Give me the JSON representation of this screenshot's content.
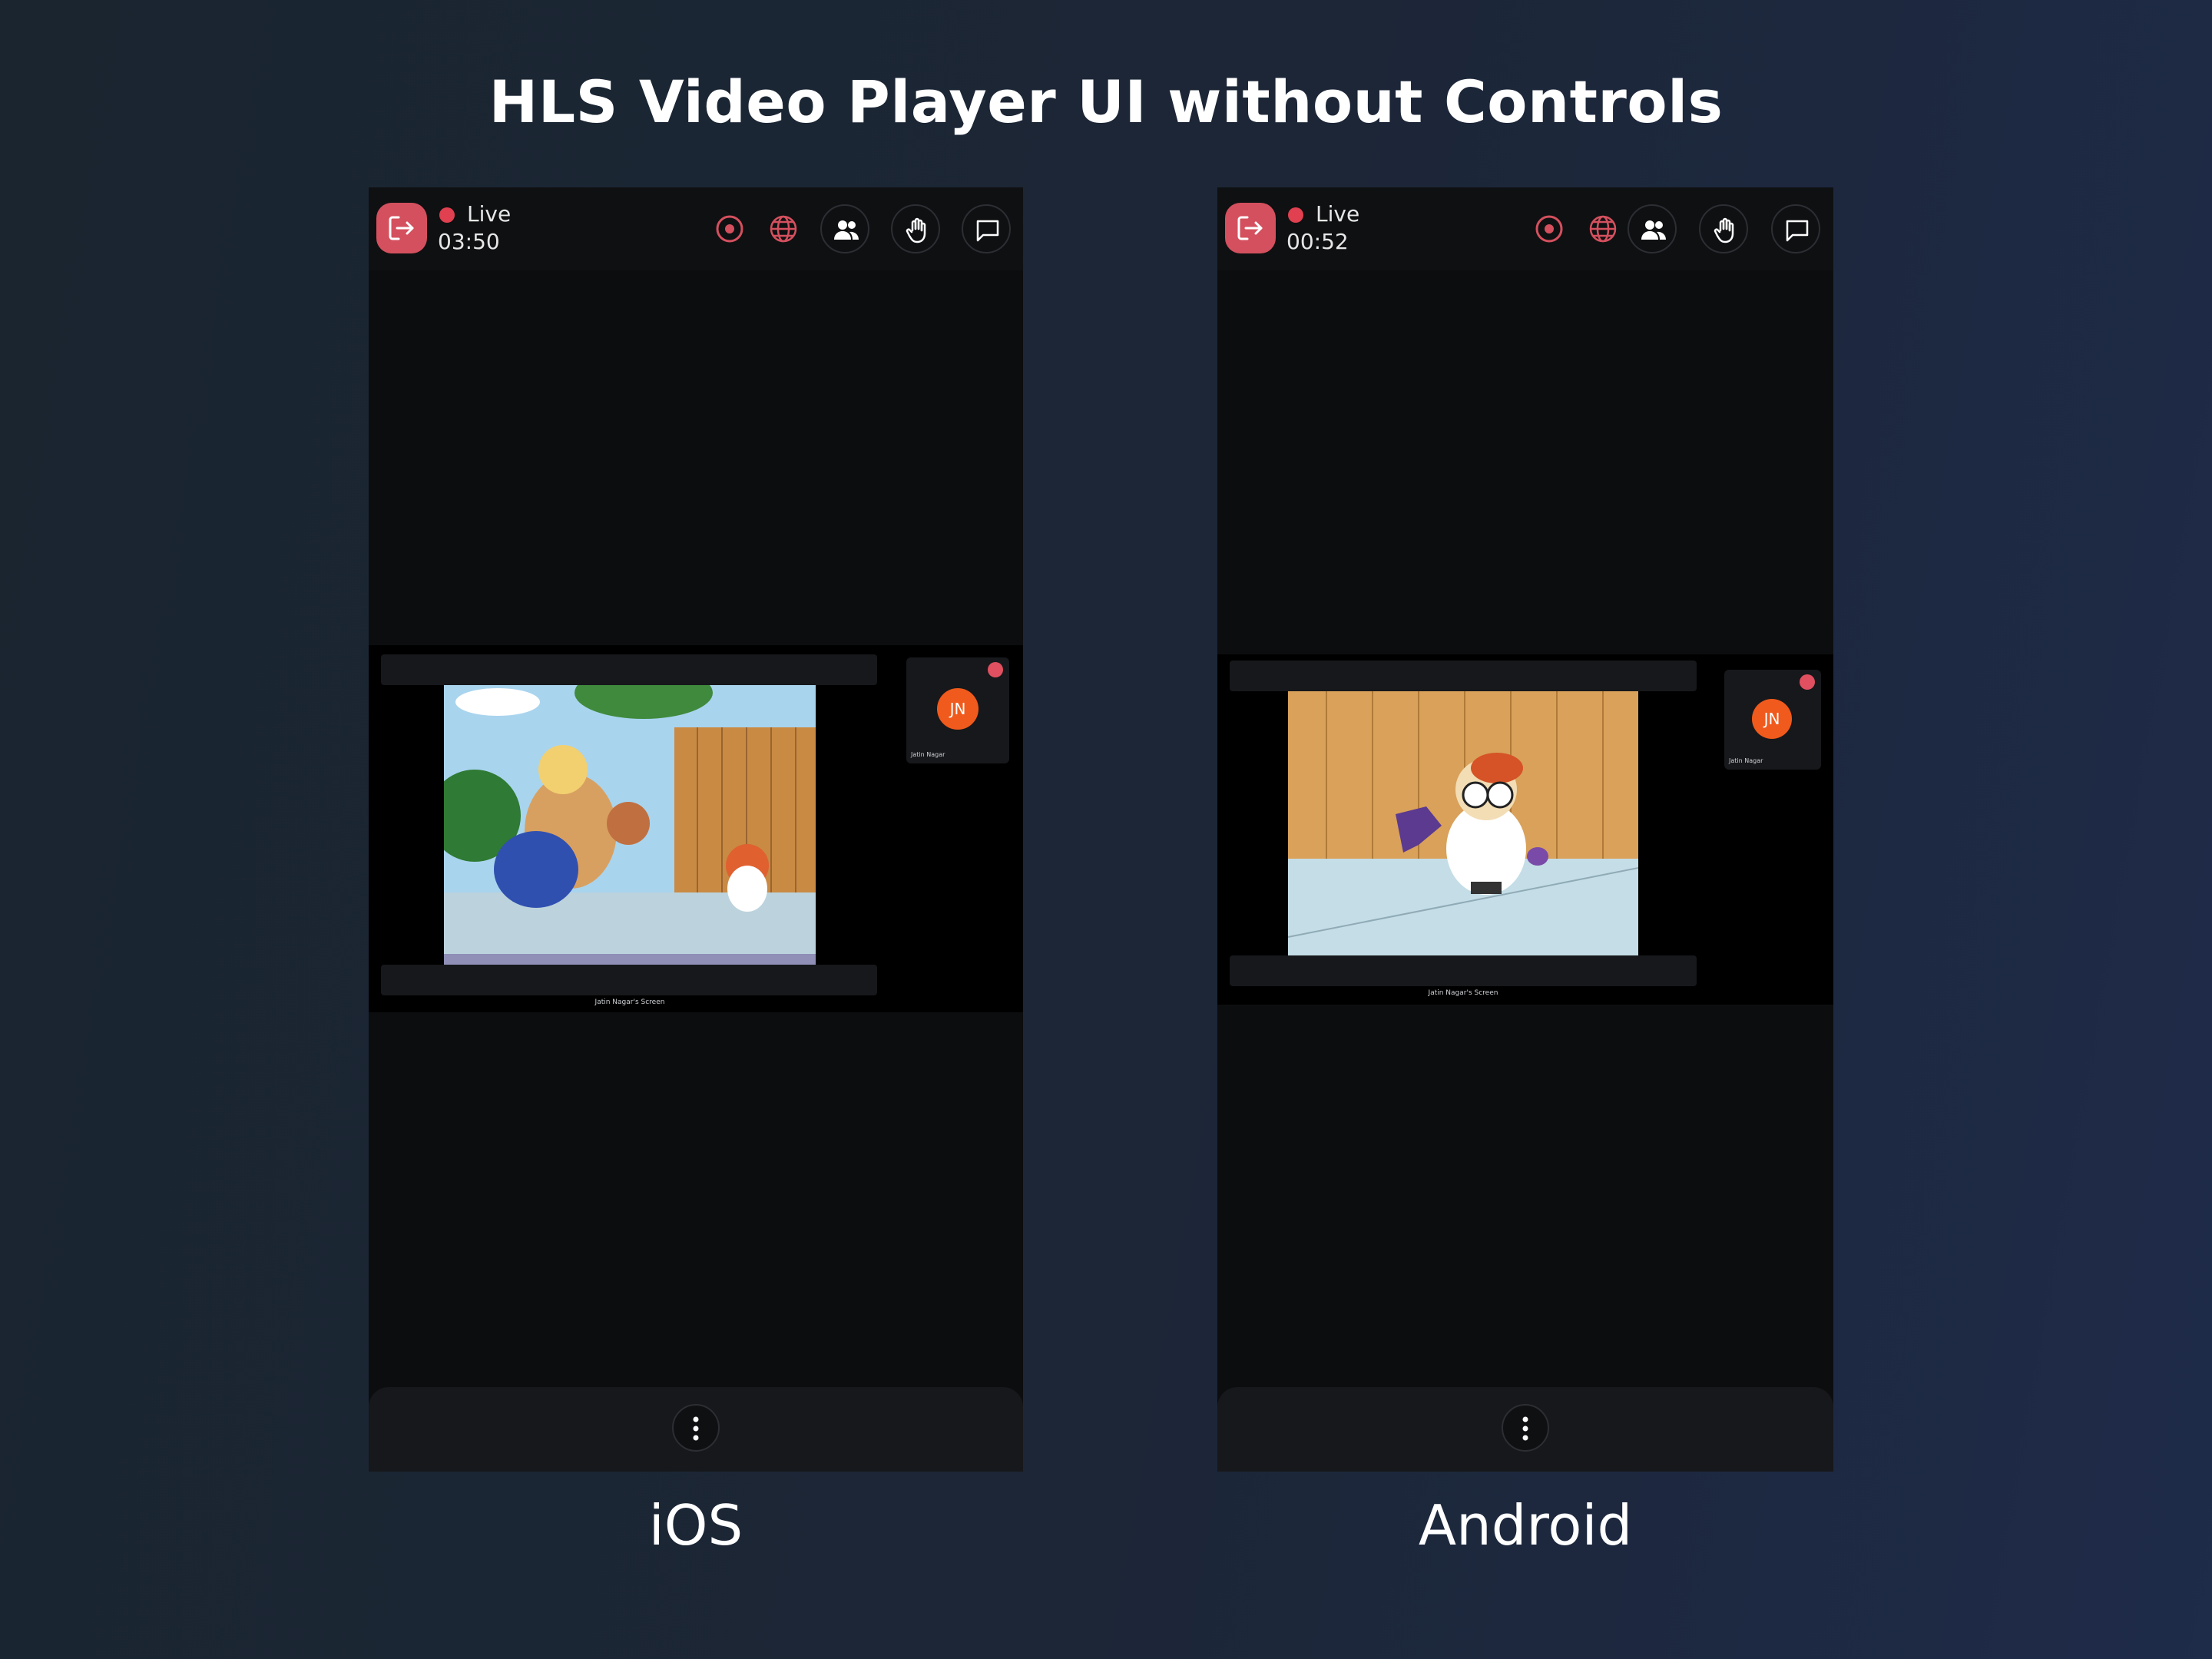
{
  "title": "HLS Video Player UI without Controls",
  "colors": {
    "background": "#1b2534",
    "accent_red": "#d4505e",
    "avatar_orange": "#f05a1c",
    "phone_bg": "#0c0d0f"
  },
  "icons": [
    "leave-icon",
    "record-icon",
    "globe-icon",
    "participants-icon",
    "hand-raise-icon",
    "chat-icon",
    "more-vertical-icon",
    "mic-off-icon"
  ],
  "phones": [
    {
      "platform": "iOS",
      "live_label": "Live",
      "timer": "03:50",
      "screen_label": "Jatin Nagar's Screen",
      "participant": {
        "initials": "JN",
        "name": "Jatin Nagar"
      }
    },
    {
      "platform": "Android",
      "live_label": "Live",
      "timer": "00:52",
      "screen_label": "Jatin Nagar's Screen",
      "participant": {
        "initials": "JN",
        "name": "Jatin Nagar"
      }
    }
  ]
}
